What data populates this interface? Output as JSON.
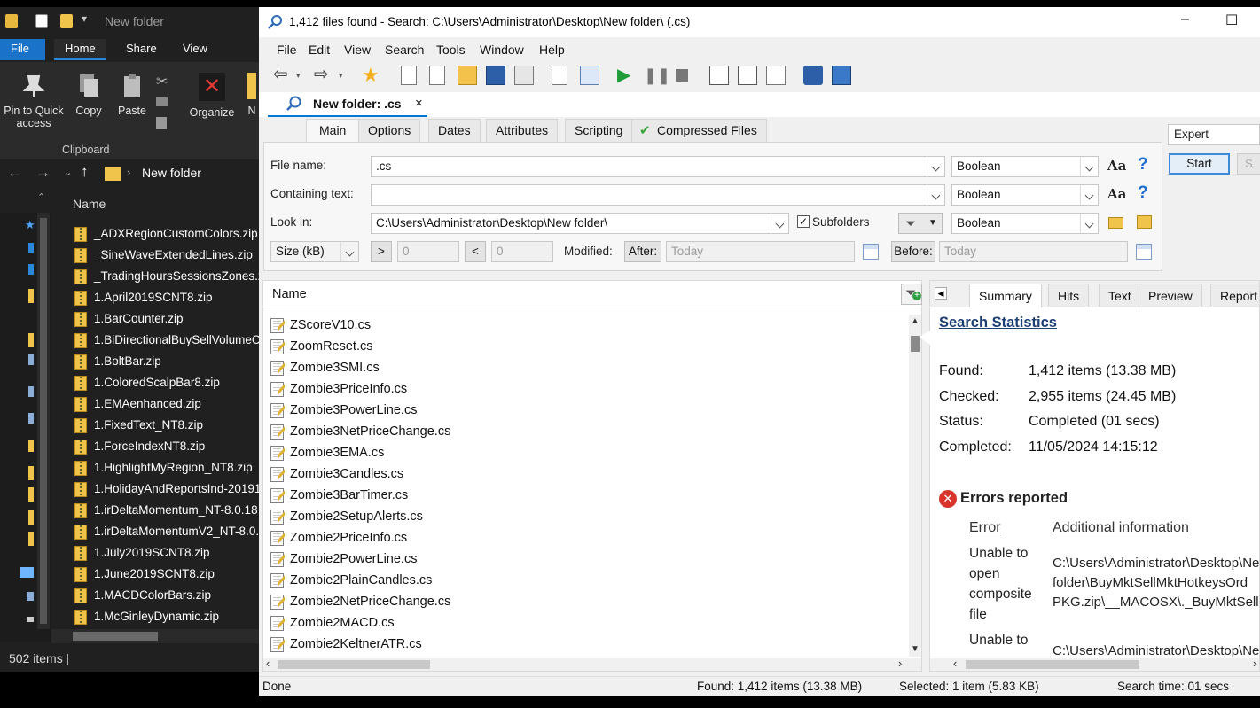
{
  "explorer": {
    "title": "New folder",
    "tabs": [
      "File",
      "Home",
      "Share",
      "View"
    ],
    "ribbon": {
      "pin": "Pin to Quick access",
      "copy": "Copy",
      "paste": "Paste",
      "organize": "Organize",
      "new_cut": "N",
      "group": "Clipboard"
    },
    "address": "New folder",
    "column": "Name",
    "items": [
      "_ADXRegionCustomColors.zip",
      "_SineWaveExtendedLines.zip",
      "_TradingHoursSessionsZones.zip",
      "1.April2019SCNT8.zip",
      "1.BarCounter.zip",
      "1.BiDirectionalBuySellVolumeC",
      "1.BoltBar.zip",
      "1.ColoredScalpBar8.zip",
      "1.EMAenhanced.zip",
      "1.FixedText_NT8.zip",
      "1.ForceIndexNT8.zip",
      "1.HighlightMyRegion_NT8.zip",
      "1.HolidayAndReportsInd-20191",
      "1.irDeltaMomentum_NT-8.0.18",
      "1.irDeltaMomentumV2_NT-8.0.",
      "1.July2019SCNT8.zip",
      "1.June2019SCNT8.zip",
      "1.MACDColorBars.zip",
      "1.McGinleyDynamic.zip"
    ],
    "status": "502 items"
  },
  "window": {
    "title": "1,412 files found - Search: C:\\Users\\Administrator\\Desktop\\New folder\\ (.cs)",
    "minimize": "–",
    "maximize": "☐",
    "menu": [
      "File",
      "Edit",
      "View",
      "Search",
      "Tools",
      "Window",
      "Help"
    ],
    "doc_tab": "New folder: .cs",
    "doc_tab_close": "×"
  },
  "criteria": {
    "tabs": [
      "Main",
      "Options",
      "Dates",
      "Attributes",
      "Scripting",
      "Compressed Files"
    ],
    "file_name_label": "File name:",
    "file_name": ".cs",
    "file_name_mode": "Boolean",
    "containing_label": "Containing text:",
    "containing": "",
    "containing_mode": "Boolean",
    "look_in_label": "Look in:",
    "look_in": "C:\\Users\\Administrator\\Desktop\\New folder\\",
    "subfolders": "Subfolders",
    "look_in_mode": "Boolean",
    "size_unit": "Size (kB)",
    "gt": ">",
    "gt_value": "0",
    "lt": "<",
    "lt_value": "0",
    "modified_label": "Modified:",
    "after_label": "After:",
    "after_value": "Today",
    "before_label": "Before:",
    "before_value": "Today",
    "aa": "Aa",
    "help": "?"
  },
  "side": {
    "mode": "Expert",
    "start": "Start",
    "stop": "S"
  },
  "results": {
    "column": "Name",
    "rows": [
      "ZScoreV10.cs",
      "ZoomReset.cs",
      "Zombie3SMI.cs",
      "Zombie3PriceInfo.cs",
      "Zombie3PowerLine.cs",
      "Zombie3NetPriceChange.cs",
      "Zombie3EMA.cs",
      "Zombie3Candles.cs",
      "Zombie3BarTimer.cs",
      "Zombie2SetupAlerts.cs",
      "Zombie2PriceInfo.cs",
      "Zombie2PowerLine.cs",
      "Zombie2PlainCandles.cs",
      "Zombie2NetPriceChange.cs",
      "Zombie2MACD.cs",
      "Zombie2KeltnerATR.cs"
    ]
  },
  "summary": {
    "tabs": [
      "Summary",
      "Hits",
      "Text",
      "Preview",
      "Report"
    ],
    "heading": "Search Statistics",
    "found_label": "Found:",
    "found": "1,412 items (13.38 MB)",
    "checked_label": "Checked:",
    "checked": "2,955 items (24.45 MB)",
    "status_label": "Status:",
    "status": "Completed (01 secs)",
    "completed_label": "Completed:",
    "completed": "11/05/2024 14:15:12",
    "errors_heading": "Errors reported",
    "col_error": "Error",
    "col_info": "Additional information",
    "error1_l1": "Unable to",
    "error1_l2": "open",
    "error1_l3": "composite",
    "error1_l4": "file",
    "info1_l1": "C:\\Users\\Administrator\\Desktop\\New",
    "info1_l2": "folder\\BuyMktSellMktHotkeysOrd",
    "info1_l3": "PKG.zip\\__MACOSX\\._BuyMktSellMkt",
    "error2_l1": "Unable to",
    "info2_l1": "C:\\Users\\Administrator\\Desktop\\New"
  },
  "statusbar": {
    "left": "Done",
    "found": "Found: 1,412 items (13.38 MB)",
    "selected": "Selected: 1 item (5.83 KB)",
    "time": "Search time: 01 secs"
  },
  "colors": {
    "accent": "#0078d7",
    "explorer_bg": "#202020",
    "folder": "#f0c34a"
  }
}
